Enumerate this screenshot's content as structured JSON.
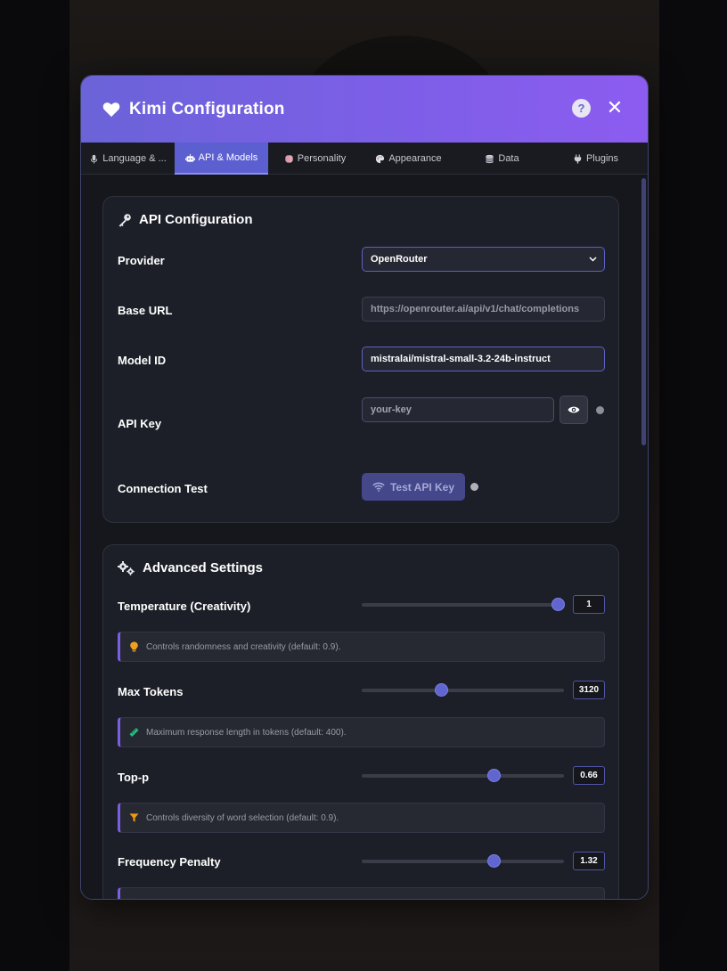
{
  "header": {
    "title": "Kimi Configuration",
    "help_icon": "?",
    "close_icon": "✕",
    "gradient": [
      "#6b63d8",
      "#8c5cf0"
    ]
  },
  "tabs": [
    {
      "label": "Language & ...",
      "icon": "microphone-icon",
      "active": false
    },
    {
      "label": "API & Models",
      "icon": "robot-icon",
      "active": true
    },
    {
      "label": "Personality",
      "icon": "brain-icon",
      "active": false
    },
    {
      "label": "Appearance",
      "icon": "palette-icon",
      "active": false
    },
    {
      "label": "Data",
      "icon": "database-icon",
      "active": false
    },
    {
      "label": "Plugins",
      "icon": "plug-icon",
      "active": false
    }
  ],
  "api_config": {
    "title": "API Configuration",
    "provider_label": "Provider",
    "provider_value": "OpenRouter",
    "base_url_label": "Base URL",
    "base_url_value": "https://openrouter.ai/api/v1/chat/completions",
    "model_id_label": "Model ID",
    "model_id_value": "mistralai/mistral-small-3.2-24b-instruct",
    "api_key_label": "API Key",
    "api_key_value": "your-key",
    "connection_test_label": "Connection Test",
    "test_button_label": "Test API Key"
  },
  "advanced": {
    "title": "Advanced Settings",
    "settings": [
      {
        "label": "Temperature (Creativity)",
        "value": "1",
        "fraction": 0.97,
        "hint": "Controls randomness and creativity (default: 0.9).",
        "hint_icon": "lightbulb-icon",
        "hint_color": "#f0a020"
      },
      {
        "label": "Max Tokens",
        "value": "3120",
        "fraction": 0.39,
        "hint": "Maximum response length in tokens (default: 400).",
        "hint_icon": "ruler-icon",
        "hint_color": "#20c080"
      },
      {
        "label": "Top-p",
        "value": "0.66",
        "fraction": 0.65,
        "hint": "Controls diversity of word selection (default: 0.9).",
        "hint_icon": "filter-icon",
        "hint_color": "#f09a10"
      },
      {
        "label": "Frequency Penalty",
        "value": "1.32",
        "fraction": 0.65,
        "hint": "",
        "hint_icon": "",
        "hint_color": "#20c0a0"
      }
    ]
  },
  "colors": {
    "accent": "#5c5fd0",
    "background": "#15171d",
    "card": "#1c1f27"
  }
}
